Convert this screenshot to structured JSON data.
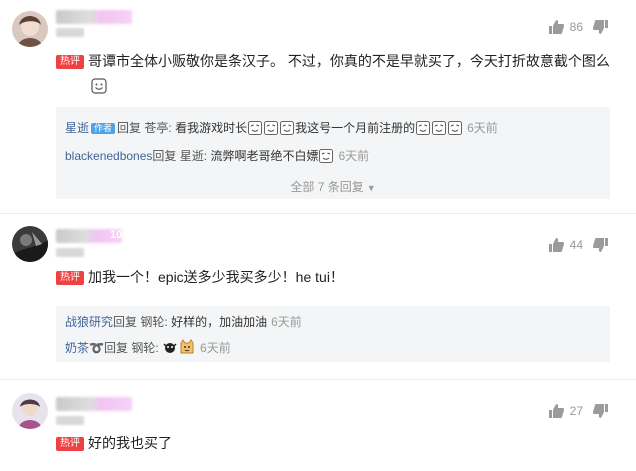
{
  "comments": [
    {
      "level": "",
      "badge": "热评",
      "likes": "86",
      "text": "哥谭市全体小贩敬你是条汉子。 不过，你真的不是早就买了，今天打折故意截个图么",
      "replies": [
        {
          "user": "星逝",
          "tag": "作者",
          "verb": "回复",
          "target": "苍亭:",
          "text1": "看我游戏时长",
          "text2": "我这号一个月前注册的",
          "time": "6天前"
        },
        {
          "user": "blackenedbones",
          "verb": "回复",
          "target": "星逝:",
          "text1": "流弊啊老哥绝不白嫖",
          "time": "6天前"
        }
      ],
      "more": "全部 7 条回复"
    },
    {
      "level": "10",
      "badge": "热评",
      "likes": "44",
      "text": "加我一个！epic送多少我买多少！he tui！",
      "replies": [
        {
          "user": "战狼研究",
          "verb": "回复",
          "target": "钢轮:",
          "text1": "好样的，加油加油",
          "time": "6天前"
        },
        {
          "user": "奶茶",
          "verb": "回复",
          "target": "钢轮:",
          "text1": "",
          "time": "6天前"
        }
      ]
    },
    {
      "level": "",
      "badge": "热评",
      "likes": "27",
      "text": "好的我也买了"
    }
  ],
  "icons": {
    "like": "thumb-up-icon",
    "dislike": "thumb-down-icon",
    "emoji": "smile-emoji-icon",
    "sticker": "face-sticker-icon",
    "expand": "chevron-down-icon"
  },
  "colors": {
    "badge": "#f04142",
    "user_link": "#406599",
    "author_tag": "#4ea3e8",
    "reply_bg": "#f4f5f6",
    "muted": "#999999"
  }
}
